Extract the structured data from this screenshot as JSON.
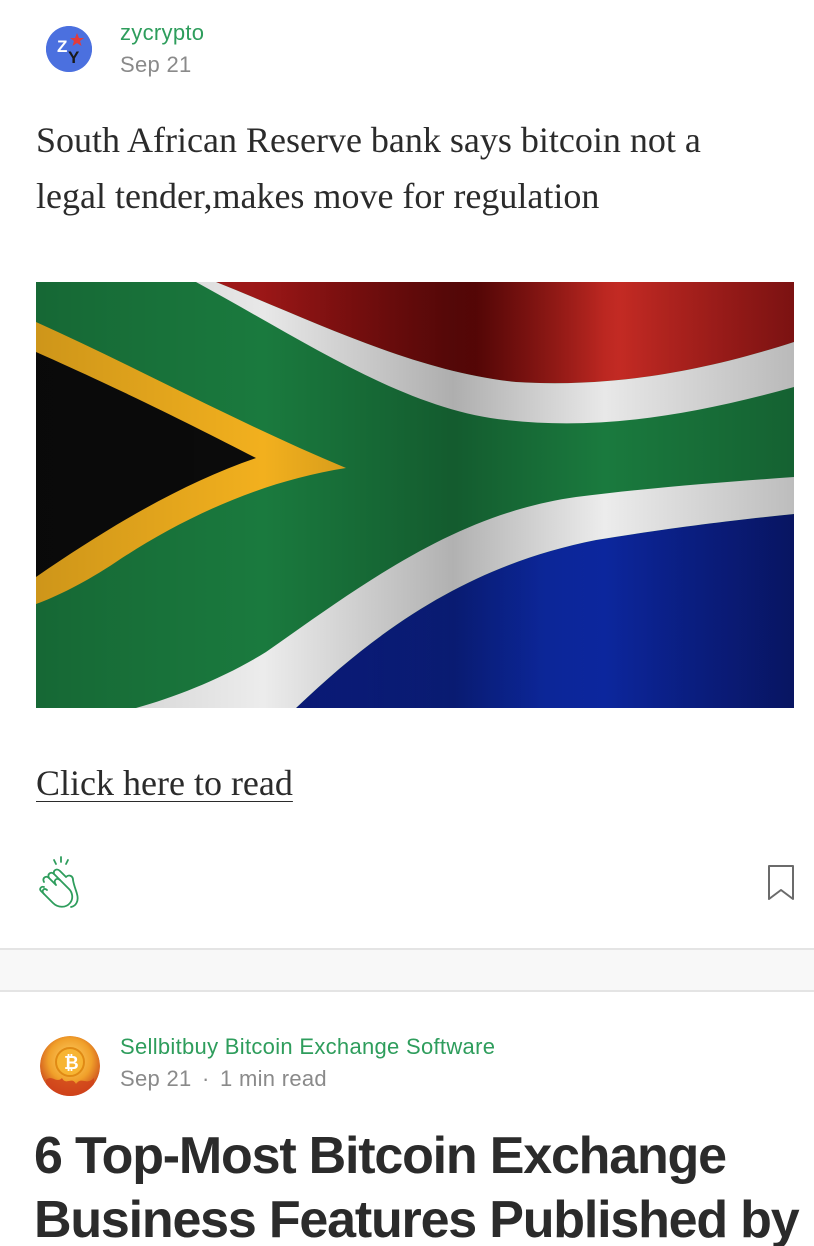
{
  "post1": {
    "author": "zycrypto",
    "date": "Sep 21",
    "title": "South African Reserve bank says bitcoin not a legal tender,makes move for regulation",
    "image_alt": "South African flag",
    "link_text": "Click here to read",
    "icons": {
      "clap": "clap-icon",
      "bookmark": "bookmark-icon"
    }
  },
  "post2": {
    "author": "Sellbitbuy Bitcoin Exchange Software",
    "date": "Sep 21",
    "separator": "·",
    "read_time": "1 min read",
    "title": "6 Top-Most Bitcoin Exchange Business Features Published by"
  },
  "colors": {
    "accent": "#2e9d5c",
    "meta": "#8a8a8a",
    "text": "#2b2b2b"
  }
}
